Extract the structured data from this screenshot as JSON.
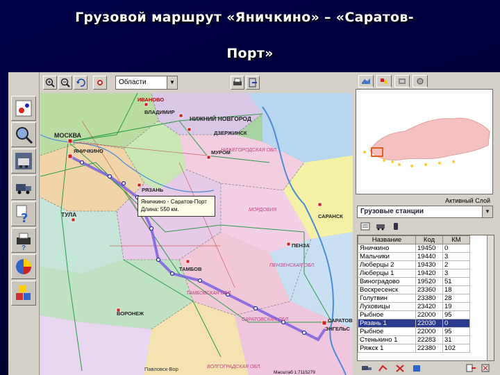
{
  "title": {
    "line1": "Грузовой маршрут «Яничкино» – «Саратов-",
    "line2": "Порт»"
  },
  "toolbar": {
    "layer_select": "Области",
    "buttons": [
      "zoom-in-icon",
      "zoom-out-icon",
      "undo-icon",
      "layers-icon",
      "print-icon",
      "exit-icon"
    ]
  },
  "sidebar": {
    "tools": [
      "map-select-icon",
      "find-icon",
      "train-icon",
      "truck-icon",
      "question-icon",
      "printer-icon",
      "pie-chart-icon",
      "cubes-icon"
    ]
  },
  "map": {
    "route_box": {
      "line1": "Яничкино - Саратов-Порт",
      "line2": "Длина: 550 км."
    },
    "labels": [
      {
        "text": "ИВАНОВО",
        "color": "#c00000"
      },
      {
        "text": "НИЖНИЙ НОВГОРОД",
        "color": "#222"
      },
      {
        "text": "МОСКВА",
        "color": "#222"
      },
      {
        "text": "ЯНИЧКИНО",
        "color": "#222"
      },
      {
        "text": "ТУЛА",
        "color": "#222"
      },
      {
        "text": "РЯЗАНЬ",
        "color": "#222"
      },
      {
        "text": "ПЕНЗА",
        "color": "#222"
      },
      {
        "text": "ТАМБОВ",
        "color": "#222"
      },
      {
        "text": "ВОРОНЕЖ",
        "color": "#222"
      },
      {
        "text": "САРАТОВ",
        "color": "#222"
      },
      {
        "text": "ЭНГЕЛЬС",
        "color": "#222"
      },
      {
        "text": "САРАНСК",
        "color": "#222"
      },
      {
        "text": "МУРОМ",
        "color": "#222"
      },
      {
        "text": "ДЗЕРЖИНСК",
        "color": "#222"
      },
      {
        "text": "ВЛАДИМИР",
        "color": "#222"
      },
      {
        "text": "МОРДОВИЯ",
        "color": "#c04080"
      },
      {
        "text": "ПЕНЗЕНСКАЯ ОБЛ.",
        "color": "#c04080"
      },
      {
        "text": "ТАМБОВСКАЯ ОБЛ.",
        "color": "#c04080"
      },
      {
        "text": "САРАТОВСКАЯ ОБЛ.",
        "color": "#c04080"
      },
      {
        "text": "НИЖЕГОРОДСКАЯ ОБЛ.",
        "color": "#c04080"
      },
      {
        "text": "ВОЛГОГРАДСКАЯ ОБЛ.",
        "color": "#c04080"
      },
      {
        "text": "Павловск-Вор",
        "color": "#333"
      },
      {
        "text": "Масштаб 1:7115279",
        "color": "#000"
      }
    ]
  },
  "right_panel": {
    "active_layer_label": "Активный Слой",
    "active_layer_value": "Грузовые станции",
    "table": {
      "headers": [
        "Название",
        "Код",
        "КМ"
      ],
      "rows": [
        [
          "Яничкино",
          "19450",
          "0"
        ],
        [
          "Мальчики",
          "19440",
          "3"
        ],
        [
          "Люберцы 2",
          "19430",
          "2"
        ],
        [
          "Люберцы 1",
          "19420",
          "3"
        ],
        [
          "Виноградово",
          "19520",
          "51"
        ],
        [
          "Воскресенск",
          "23360",
          "18"
        ],
        [
          "Голутвин",
          "23380",
          "28"
        ],
        [
          "Луховицы",
          "23420",
          "19"
        ],
        [
          "Рыбное",
          "22000",
          "95"
        ],
        [
          "Рязань 1",
          "22030",
          "0"
        ],
        [
          "Рыбное",
          "22000",
          "95"
        ],
        [
          "Стенькино 1",
          "22283",
          "31"
        ],
        [
          "Ряжск 1",
          "22380",
          "102"
        ]
      ],
      "selected_index": 9
    }
  }
}
